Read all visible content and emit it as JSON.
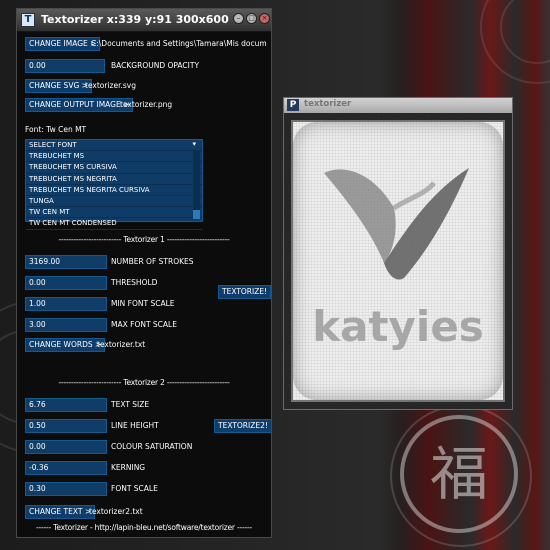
{
  "main_window": {
    "title": "Textorizer x:339 y:91 300x600",
    "change_image": {
      "button": "CHANGE IMAGE >",
      "path": "C:\\Documents and Settings\\Tamara\\Mis docum"
    },
    "background_opacity": {
      "value": "0.00",
      "label": "BACKGROUND OPACITY"
    },
    "change_svg": {
      "button": "CHANGE SVG >",
      "file": "textorizer.svg"
    },
    "change_output": {
      "button": "CHANGE OUTPUT IMAGE >",
      "file": "textorizer.png"
    },
    "font": {
      "label": "Font: Tw Cen MT",
      "options": [
        "SELECT FONT",
        "TREBUCHET MS",
        "TREBUCHET MS CURSIVA",
        "TREBUCHET MS NEGRITA",
        "TREBUCHET MS NEGRITA CURSIVA",
        "TUNGA",
        "TW CEN MT",
        "TW CEN MT CONDENSED"
      ]
    },
    "section1": {
      "header": "------------------------- Textorizer 1 -------------------------",
      "number_of_strokes": {
        "value": "3169.00",
        "label": "NUMBER OF STROKES"
      },
      "threshold": {
        "value": "0.00",
        "label": "THRESHOLD"
      },
      "min_font_scale": {
        "value": "1.00",
        "label": "MIN FONT SCALE"
      },
      "max_font_scale": {
        "value": "3.00",
        "label": "MAX FONT SCALE"
      },
      "textorize_button": "TEXTORIZE!",
      "change_words": {
        "button": "CHANGE WORDS >",
        "file": "textorizer.txt"
      }
    },
    "section2": {
      "header": "------------------------- Textorizer 2 -------------------------",
      "text_size": {
        "value": "6.76",
        "label": "TEXT SIZE"
      },
      "line_height": {
        "value": "0.50",
        "label": "LINE HEIGHT"
      },
      "colour_saturation": {
        "value": "0.00",
        "label": "COLOUR SATURATION"
      },
      "kerning": {
        "value": "-0.36",
        "label": "KERNING"
      },
      "font_scale": {
        "value": "0.30",
        "label": "FONT SCALE"
      },
      "textorize2_button": "TEXTORIZE2!",
      "change_text": {
        "button": "CHANGE TEXT >",
        "file": "textorizer2.txt"
      }
    },
    "footer": "------ Textorizer - http://lapin-bleu.net/software/textorizer ------"
  },
  "preview_window": {
    "icon_letter": "P",
    "title": "textorizer",
    "logo_word": "katyies"
  },
  "desktop": {
    "emblem_glyph": "福"
  },
  "colors": {
    "button_blue": "#0f3d6b",
    "desktop_red": "#6b1818"
  }
}
